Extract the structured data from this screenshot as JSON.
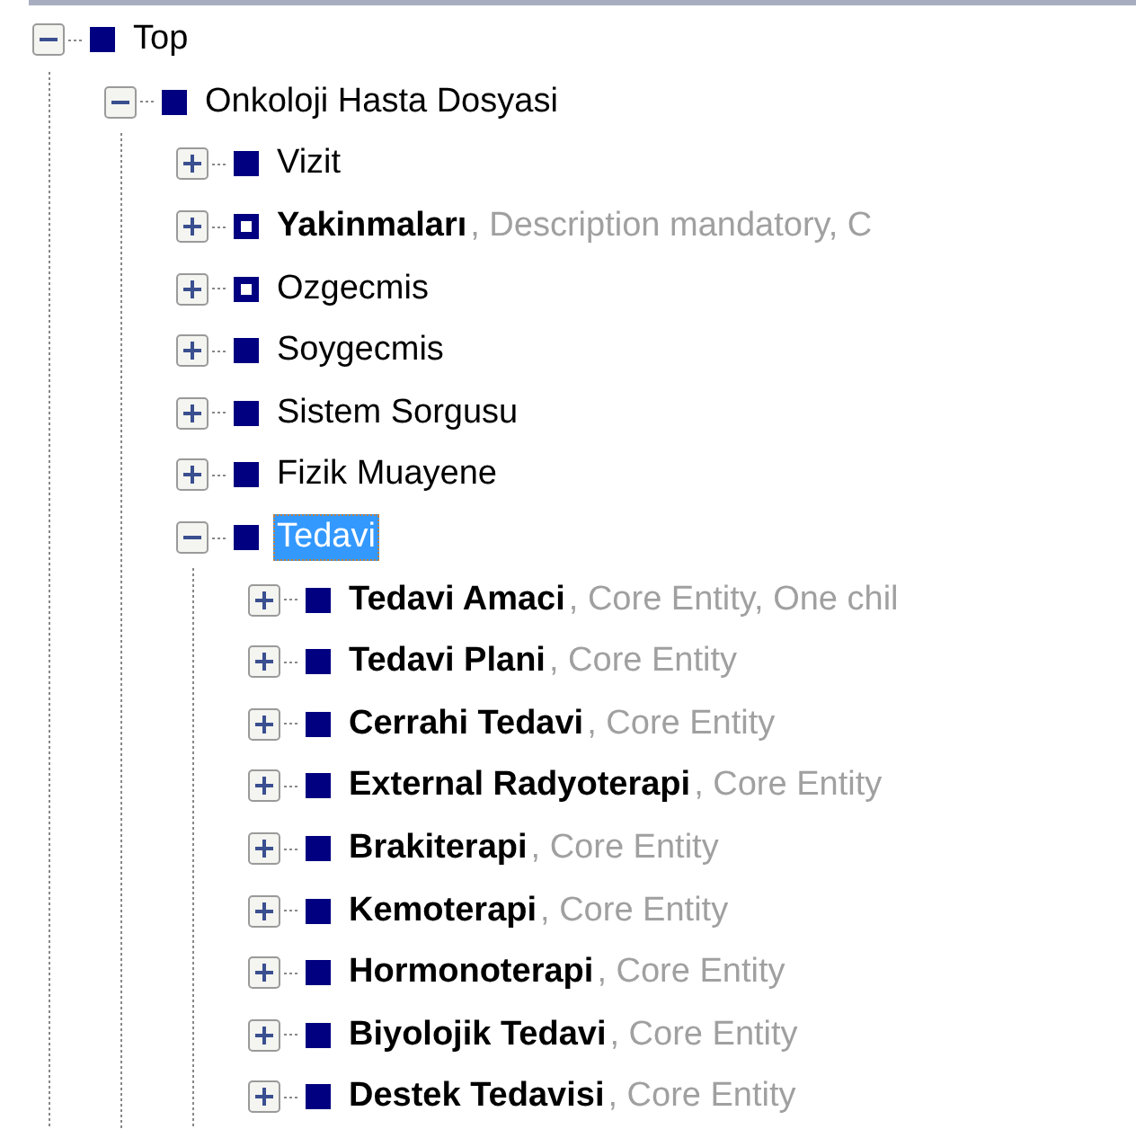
{
  "tree": [
    {
      "name": "Top",
      "kind": "filled",
      "bold": false,
      "expanded": true,
      "selected": false,
      "children": [
        {
          "name": "Onkoloji Hasta Dosyasi",
          "kind": "filled",
          "bold": false,
          "expanded": true,
          "selected": false,
          "children": [
            {
              "name": "Vizit",
              "kind": "filled",
              "bold": false,
              "expanded": false,
              "selected": false
            },
            {
              "name": "Yakinmaları",
              "description": ", Description mandatory, C",
              "kind": "hollow",
              "bold": true,
              "expanded": false,
              "selected": false
            },
            {
              "name": "Ozgecmis",
              "kind": "hollow",
              "bold": false,
              "expanded": false,
              "selected": false
            },
            {
              "name": "Soygecmis",
              "kind": "filled",
              "bold": false,
              "expanded": false,
              "selected": false
            },
            {
              "name": "Sistem Sorgusu",
              "kind": "filled",
              "bold": false,
              "expanded": false,
              "selected": false
            },
            {
              "name": "Fizik Muayene",
              "kind": "filled",
              "bold": false,
              "expanded": false,
              "selected": false
            },
            {
              "name": "Tedavi",
              "kind": "filled",
              "bold": false,
              "expanded": true,
              "selected": true,
              "children": [
                {
                  "name": "Tedavi Amaci",
                  "description": ", Core Entity, One chil",
                  "kind": "filled",
                  "bold": true,
                  "expanded": false,
                  "selected": false
                },
                {
                  "name": "Tedavi Plani",
                  "description": ", Core Entity",
                  "kind": "filled",
                  "bold": true,
                  "expanded": false,
                  "selected": false
                },
                {
                  "name": "Cerrahi Tedavi",
                  "description": ", Core Entity",
                  "kind": "filled",
                  "bold": true,
                  "expanded": false,
                  "selected": false
                },
                {
                  "name": "External Radyoterapi",
                  "description": ", Core Entity",
                  "kind": "filled",
                  "bold": true,
                  "expanded": false,
                  "selected": false
                },
                {
                  "name": "Brakiterapi",
                  "description": ", Core Entity",
                  "kind": "filled",
                  "bold": true,
                  "expanded": false,
                  "selected": false
                },
                {
                  "name": "Kemoterapi",
                  "description": ", Core Entity",
                  "kind": "filled",
                  "bold": true,
                  "expanded": false,
                  "selected": false
                },
                {
                  "name": "Hormonoterapi",
                  "description": ", Core Entity",
                  "kind": "filled",
                  "bold": true,
                  "expanded": false,
                  "selected": false
                },
                {
                  "name": "Biyolojik Tedavi",
                  "description": ", Core Entity",
                  "kind": "filled",
                  "bold": true,
                  "expanded": false,
                  "selected": false
                },
                {
                  "name": "Destek Tedavisi",
                  "description": ", Core Entity",
                  "kind": "filled",
                  "bold": true,
                  "expanded": false,
                  "selected": false
                }
              ]
            }
          ]
        }
      ]
    }
  ]
}
